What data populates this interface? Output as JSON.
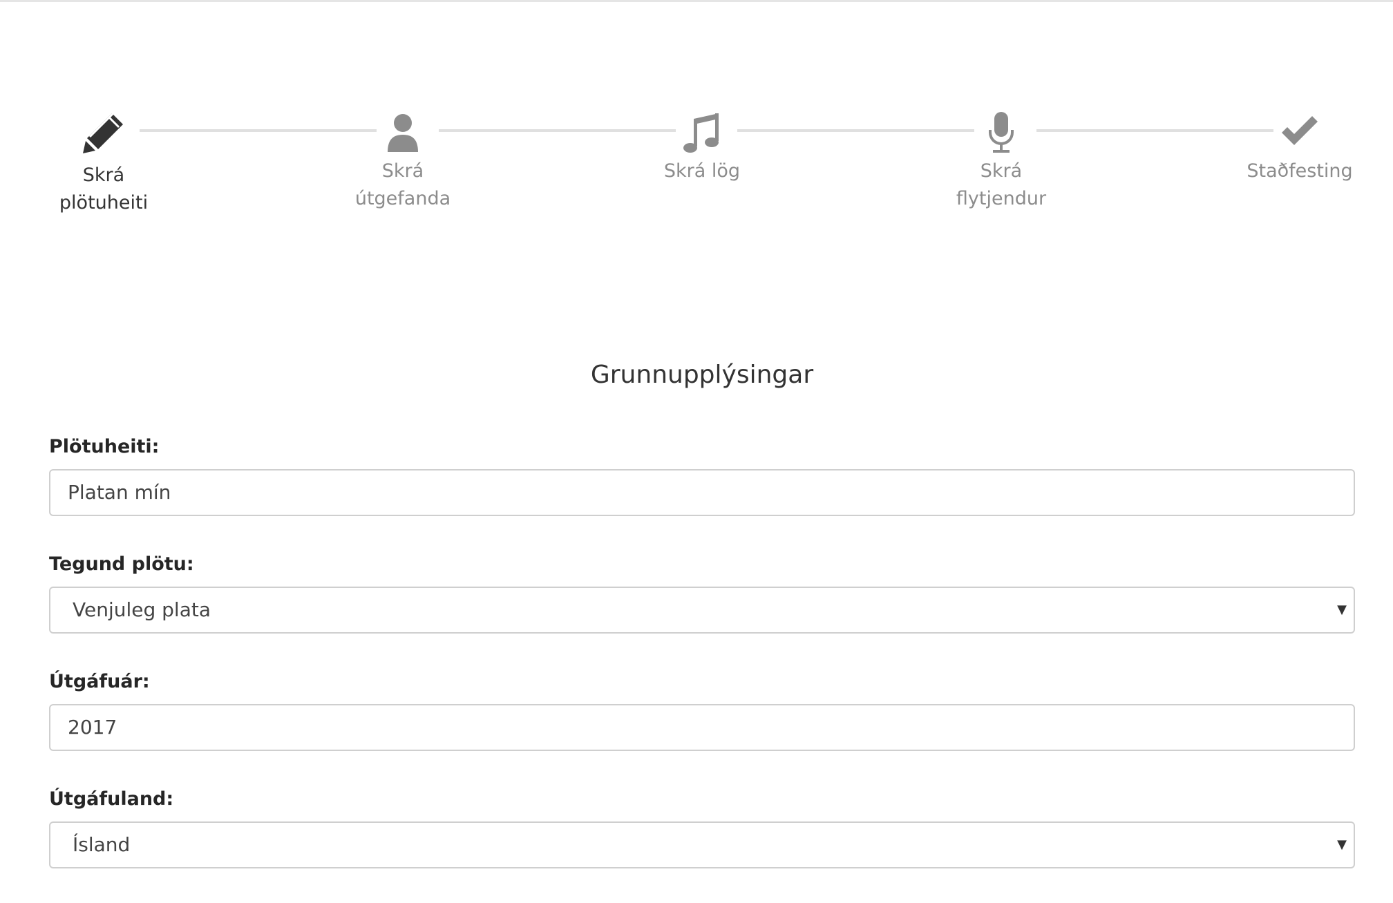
{
  "stepper": {
    "steps": [
      {
        "label_line1": "Skrá",
        "label_line2": "plötuheiti",
        "icon": "pencil-icon",
        "active": true
      },
      {
        "label_line1": "Skrá",
        "label_line2": "útgefanda",
        "icon": "user-icon",
        "active": false
      },
      {
        "label_line1": "Skrá lög",
        "label_line2": "",
        "icon": "music-note-icon",
        "active": false
      },
      {
        "label_line1": "Skrá",
        "label_line2": "flytjendur",
        "icon": "microphone-icon",
        "active": false
      },
      {
        "label_line1": "Staðfesting",
        "label_line2": "",
        "icon": "checkmark-icon",
        "active": false
      }
    ]
  },
  "colors": {
    "active": "#333333",
    "inactive": "#8c8c8c",
    "connector": "#e0e0e0",
    "border": "#cfcfcf"
  },
  "form": {
    "title": "Grunnupplýsingar",
    "album_title": {
      "label": "Plötuheiti:",
      "value": "Platan mín"
    },
    "album_type": {
      "label": "Tegund plötu:",
      "selected": "Venjuleg plata"
    },
    "release_year": {
      "label": "Útgáfuár:",
      "value": "2017"
    },
    "release_country": {
      "label": "Útgáfuland:",
      "selected": "Ísland"
    }
  }
}
